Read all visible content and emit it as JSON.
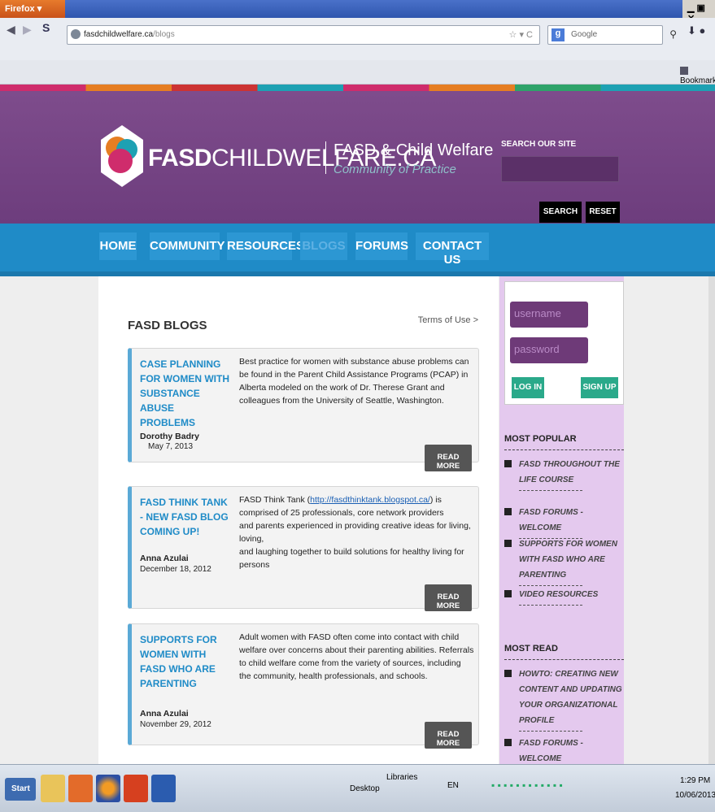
{
  "browser": {
    "app_button": "Firefox ▾",
    "url_domain": "fasdchildwelfare.ca",
    "url_path": "/blogs",
    "search_placeholder": "Google",
    "bookmarks_label": "Bookmark"
  },
  "site": {
    "logo_bold": "FASD",
    "logo_rest": "CHILDWELFARE.CA",
    "tagline_1": "FASD & Child Welfare",
    "tagline_2": "Community of Practice",
    "search_label": "SEARCH OUR SITE",
    "search_button": "SEARCH",
    "reset_button": "RESET"
  },
  "menu": [
    "HOME",
    "COMMUNITY",
    "RESOURCES",
    "BLOGS",
    "FORUMS",
    "CONTACT US"
  ],
  "blogs": {
    "heading": "FASD BLOGS",
    "terms": "Terms of Use >",
    "read_more": "READ MORE",
    "posts": [
      {
        "title": "CASE PLANNING FOR WOMEN WITH SUBSTANCE ABUSE PROBLEMS",
        "text": "Best practice for women with substance abuse problems can be found in the Parent Child Assistance Programs (PCAP) in Alberta modeled on the work of Dr. Therese Grant and colleagues from the University of Seattle, Washington.",
        "author": "Dorothy Badry",
        "date": "May 7, 2013"
      },
      {
        "title": "FASD THINK TANK - NEW FASD BLOG COMING UP!",
        "text_pre": "FASD Think Tank (",
        "text_link": "http://fasdthinktank.blogspot.ca/",
        "text_post": ") is comprised of 25 professionals, core network providers",
        "text_line2": "and parents experienced in providing creative ideas for living, loving,",
        "text_line3": "and laughing together to build solutions for healthy living for persons",
        "author": "Anna Azulai",
        "date": "December 18, 2012"
      },
      {
        "title": "SUPPORTS FOR WOMEN WITH FASD WHO ARE PARENTING",
        "text": "Adult women with FASD often come into contact with child welfare over concerns about their parenting abilities. Referrals to child welfare come from the variety of sources, including the community, health professionals, and schools.",
        "author": "Anna Azulai",
        "date": "November 29, 2012"
      }
    ]
  },
  "sidebar": {
    "username_placeholder": "username",
    "password_placeholder": "password",
    "login": "LOG IN",
    "signup": "SIGN UP",
    "most_popular": "MOST POPULAR",
    "popular_items": [
      "FASD THROUGHOUT THE LIFE COURSE",
      "FASD FORUMS - WELCOME",
      "SUPPORTS FOR WOMEN WITH FASD WHO ARE PARENTING",
      "VIDEO RESOURCES"
    ],
    "most_read": "MOST READ",
    "read_items": [
      "HOWTO: CREATING NEW CONTENT AND UPDATING YOUR ORGANIZATIONAL PROFILE",
      "FASD FORUMS - WELCOME"
    ]
  },
  "taskbar": {
    "start": "Start",
    "desktop": "Desktop",
    "libraries": "Libraries",
    "lang": "EN",
    "time": "1:29 PM",
    "date": "10/06/2013"
  }
}
